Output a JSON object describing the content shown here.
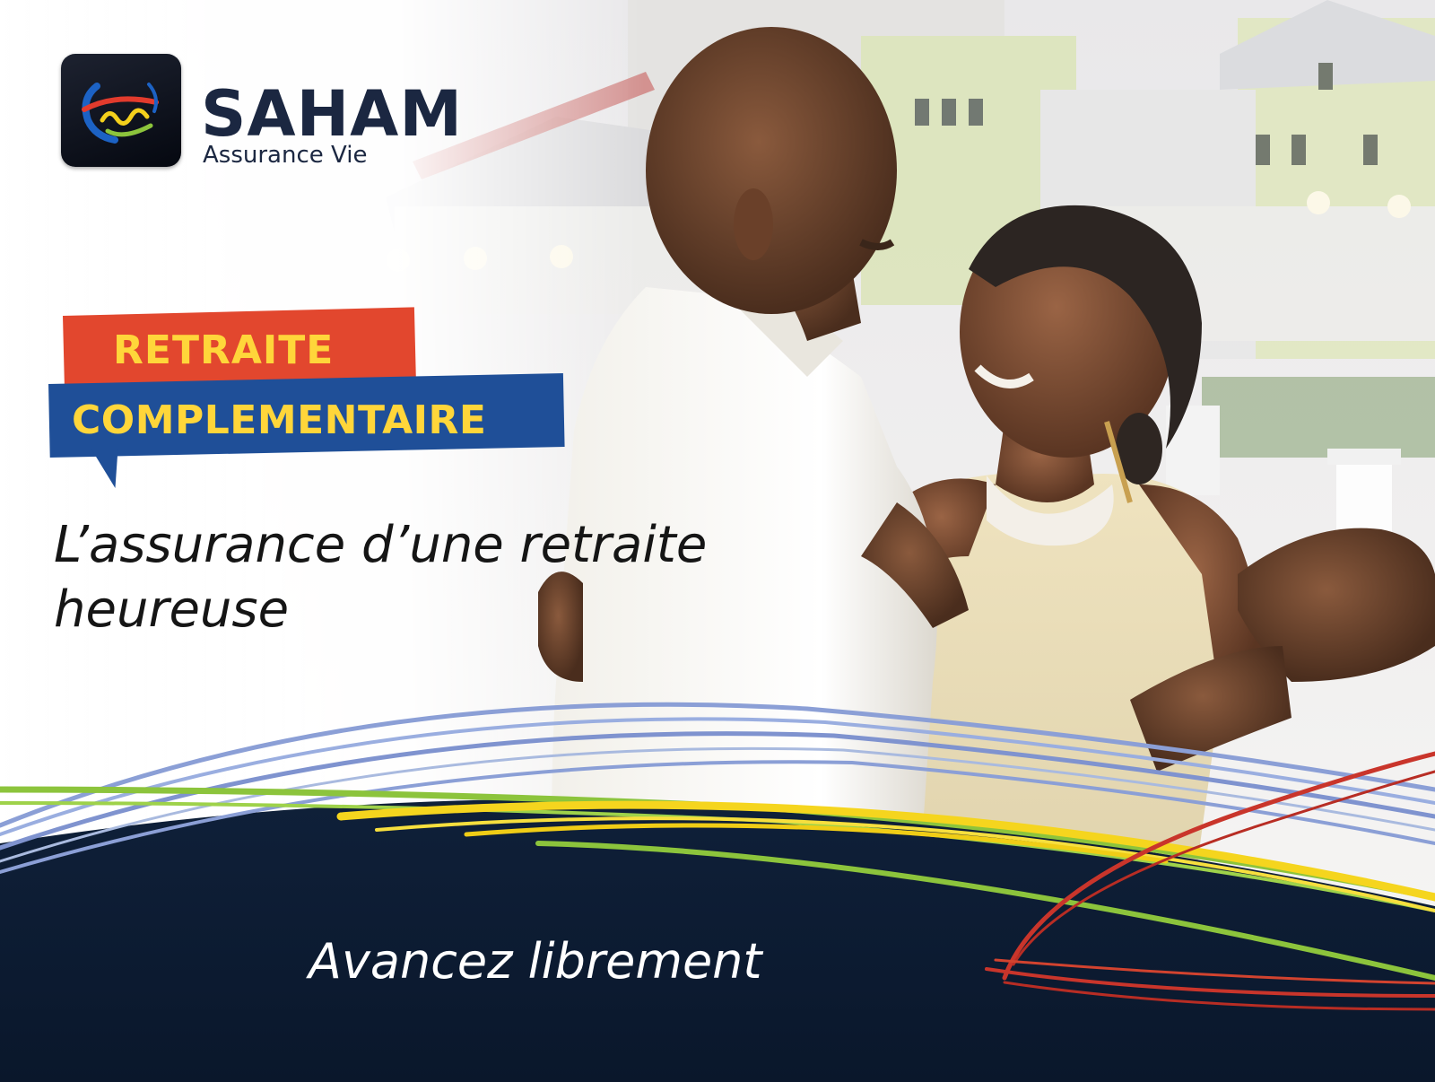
{
  "brand": {
    "name": "SAHAM",
    "subtitle": "Assurance Vie",
    "logo_icon": "saham-swirl-logo"
  },
  "tags": {
    "line1": "RETRAITE",
    "line2": "COMPLEMENTAIRE"
  },
  "headline": {
    "line1": "L’assurance d’une retraite",
    "line2": "heureuse"
  },
  "slogan": "Avancez librement",
  "colors": {
    "navy": "#0e1d33",
    "tag_red": "#e2472e",
    "tag_blue": "#1f4f98",
    "tag_text_yellow": "#ffd63a",
    "wave_blue": "#8b9fd6",
    "wave_green": "#8cc43c",
    "wave_yellow": "#f5d51e",
    "wave_red": "#c9352b"
  }
}
